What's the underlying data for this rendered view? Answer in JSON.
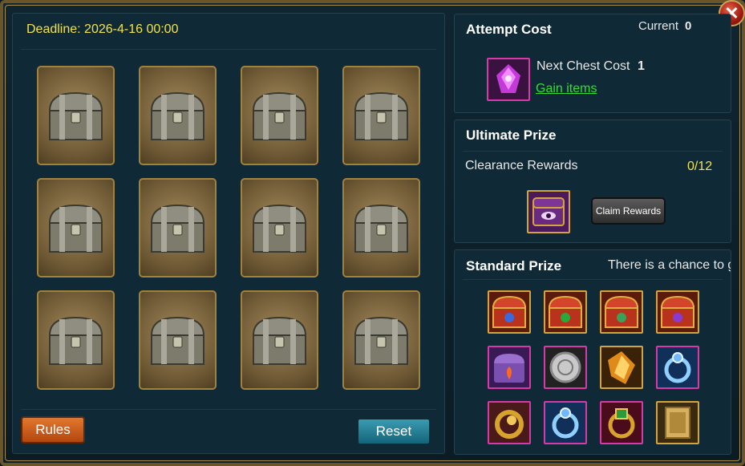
{
  "deadline": "Deadline: 2026-4-16 00:00",
  "buttons": {
    "rules": "Rules",
    "reset": "Reset",
    "claim": "Claim Rewards",
    "close": "✕"
  },
  "attempt": {
    "title": "Attempt Cost",
    "current_label": "Current",
    "current_value": "0",
    "next_label": "Next Chest Cost",
    "next_value": "1",
    "gain_label": "Gain items",
    "cost_icon": "purple-crystal-icon"
  },
  "ultimate": {
    "title": "Ultimate Prize",
    "clearance_label": "Clearance Rewards",
    "progress": "0/12",
    "reward_icon": "purple-chest-icon"
  },
  "standard": {
    "title": "Standard Prize",
    "note": "There is a chance to ge",
    "prizes": [
      "red-chest-blue-crown-icon",
      "red-chest-green-fleur-icon",
      "red-chest-green-crest-icon",
      "red-chest-purple-skull-icon",
      "purple-fire-chest-icon",
      "silver-coin-icon",
      "amber-crystal-icon",
      "blue-ring-icon",
      "gold-ring-icon",
      "blue-ring-icon",
      "gem-ring-icon",
      "golden-scroll-icon"
    ]
  },
  "chests_count": 12,
  "colors": {
    "deadline": "#f2e24a",
    "gain": "#33dd33",
    "progress": "#f2e24a"
  }
}
